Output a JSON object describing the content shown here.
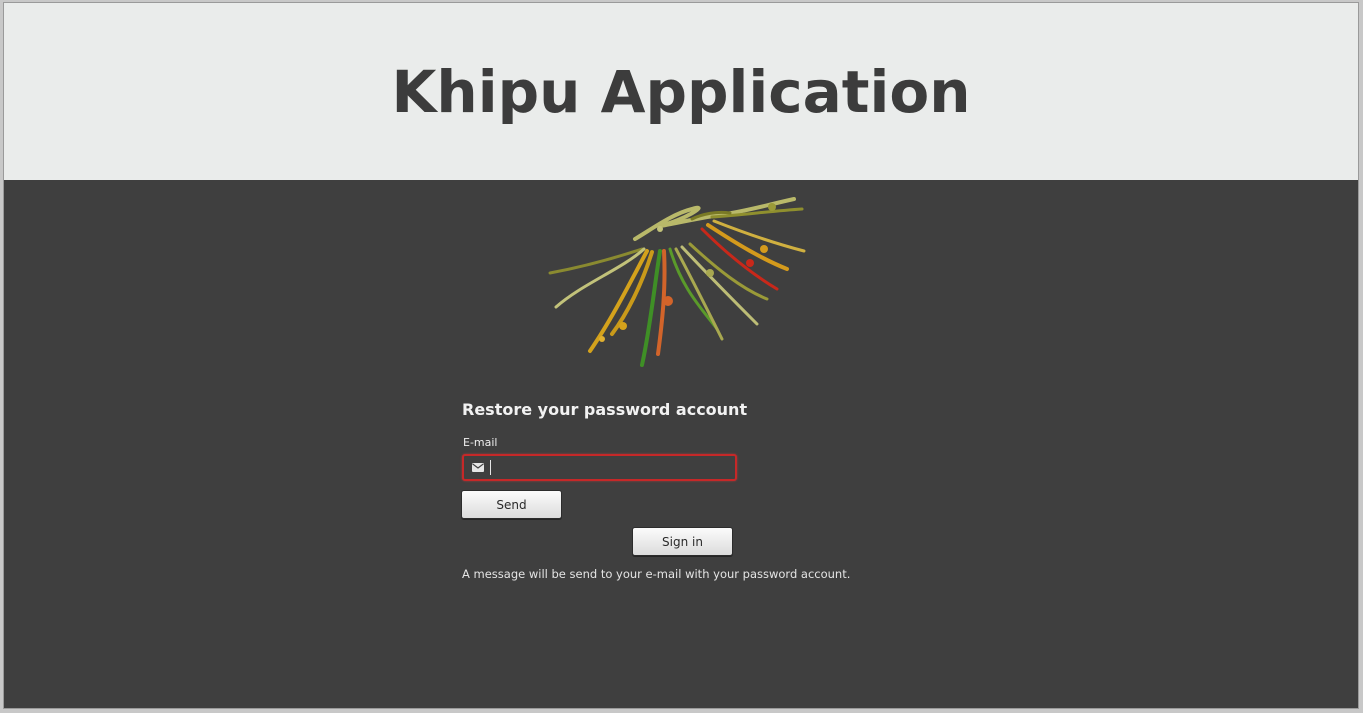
{
  "header": {
    "title": "Khipu Application"
  },
  "logo": {
    "icon": "khipu-cords-logo",
    "colors": [
      "#b8b86a",
      "#8a8a2a",
      "#d8a41c",
      "#4a9a2a",
      "#d2602a",
      "#c82a1a",
      "#d0d07a"
    ]
  },
  "form": {
    "title": "Restore your password account",
    "email_label": "E-mail",
    "email_value": "",
    "email_placeholder": "",
    "email_icon": "envelope-icon",
    "send_label": "Send",
    "signin_label": "Sign in",
    "info_text": "A message will be send to your e-mail with your password account."
  },
  "colors": {
    "header_bg": "#eaeceb",
    "body_bg": "#3f3f3f",
    "error_border": "#c62828"
  }
}
